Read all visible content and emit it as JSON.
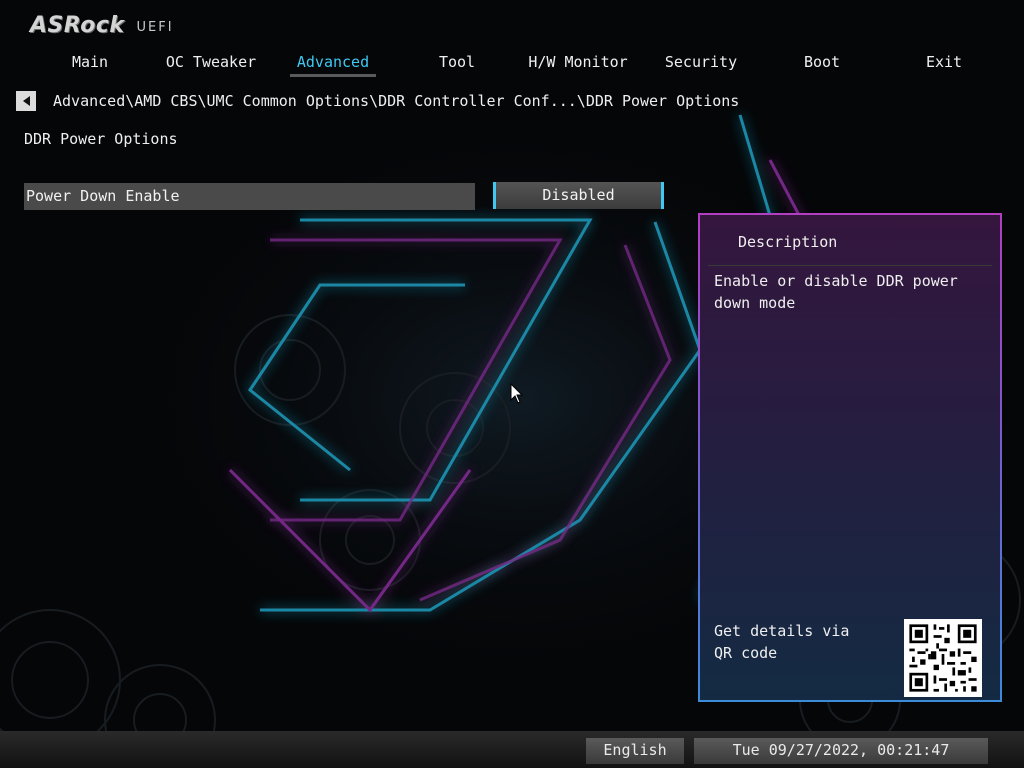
{
  "brand": {
    "logo": "ASRock",
    "product": "UEFI"
  },
  "nav": {
    "tabs": [
      {
        "label": "Main"
      },
      {
        "label": "OC Tweaker"
      },
      {
        "label": "Advanced",
        "active": true
      },
      {
        "label": "Tool"
      },
      {
        "label": "H/W Monitor"
      },
      {
        "label": "Security"
      },
      {
        "label": "Boot"
      },
      {
        "label": "Exit"
      }
    ]
  },
  "breadcrumb": {
    "path": "Advanced\\AMD CBS\\UMC Common Options\\DDR Controller Conf...\\DDR Power Options",
    "back_icon": "back-arrow-icon"
  },
  "page": {
    "title": "DDR Power Options"
  },
  "settings": [
    {
      "label": "Power Down Enable",
      "value": "Disabled"
    }
  ],
  "description": {
    "heading": "Description",
    "text": "Enable or disable DDR power down mode",
    "qr_text": "Get details via QR code",
    "qr_icon": "qr-code-icon"
  },
  "status": {
    "language": "English",
    "datetime": "Tue 09/27/2022, 00:21:47"
  },
  "colors": {
    "accent": "#3ec8f2",
    "panel_border_top": "#b23ec2",
    "panel_border_bottom": "#3d8ad8",
    "background": "#050608"
  }
}
